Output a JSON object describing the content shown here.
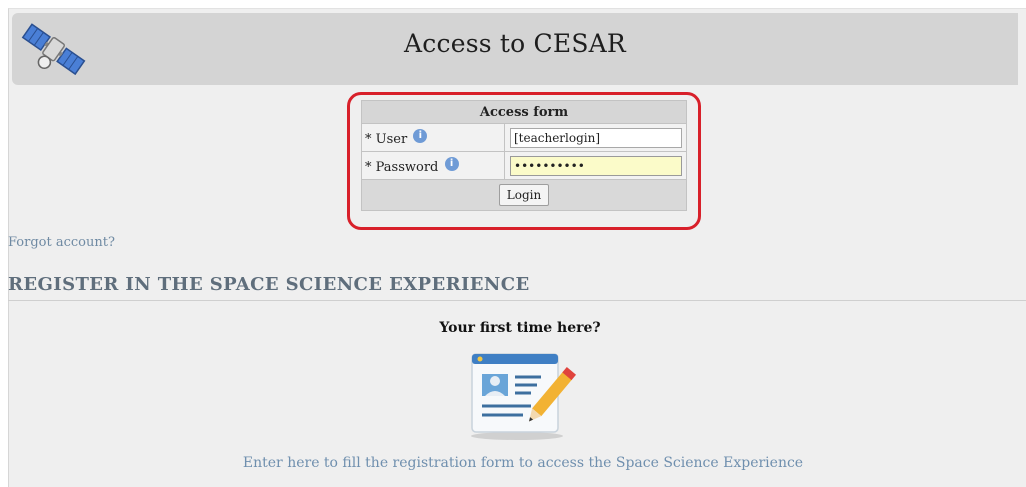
{
  "header": {
    "title": "Access to CESAR",
    "logo_icon": "satellite-icon"
  },
  "access_form": {
    "title": "Access form",
    "user_label": "* User",
    "user_value": "[teacherlogin]",
    "password_label": "* Password",
    "password_value": "..........",
    "login_label": "Login",
    "info_icon": "info-icon"
  },
  "links": {
    "forgot": "Forgot account?"
  },
  "register": {
    "heading": "REGISTER IN THE SPACE SCIENCE EXPERIENCE",
    "first_time": "Your first time here?",
    "icon": "registration-form-icon",
    "link_text": "Enter here to fill the registration form to access the Space Science Experience"
  },
  "colors": {
    "highlight": "#d8202a",
    "link": "#6f8aa3",
    "header_bg": "#d4d4d4"
  }
}
